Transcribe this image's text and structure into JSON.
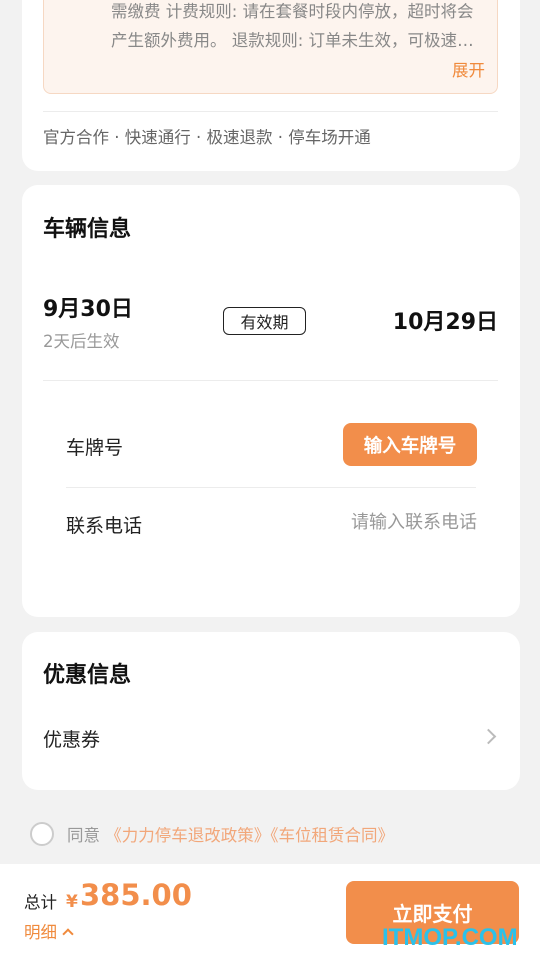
{
  "top_card": {
    "rules_text": "需缴费 计费规则: 请在套餐时段内停放，超时将会产生额外费用。 退款规则: 订单未生效，可极速退款",
    "expand_label": "展开",
    "features": "官方合作 · 快速通行 · 极速退款 · 停车场开通"
  },
  "vehicle": {
    "title": "车辆信息",
    "start_date": "9月30日",
    "start_note": "2天后生效",
    "validity_label": "有效期",
    "end_date": "10月29日",
    "plate_label": "车牌号",
    "plate_button": "输入车牌号",
    "phone_label": "联系电话",
    "phone_placeholder": "请输入联系电话"
  },
  "discount": {
    "title": "优惠信息",
    "coupon_label": "优惠券"
  },
  "agreement": {
    "prefix": "同意",
    "policy_link": "《力力停车退改政策》",
    "contract_link": "《车位租赁合同》"
  },
  "bottom": {
    "total_label": "总计",
    "currency": "¥",
    "price": "385.00",
    "detail_label": "明细",
    "pay_button": "立即支付"
  },
  "watermark": "ITMOP.COM",
  "colors": {
    "accent": "#f28e4b",
    "link": "#f08a3c",
    "background": "#f2f2f2"
  }
}
